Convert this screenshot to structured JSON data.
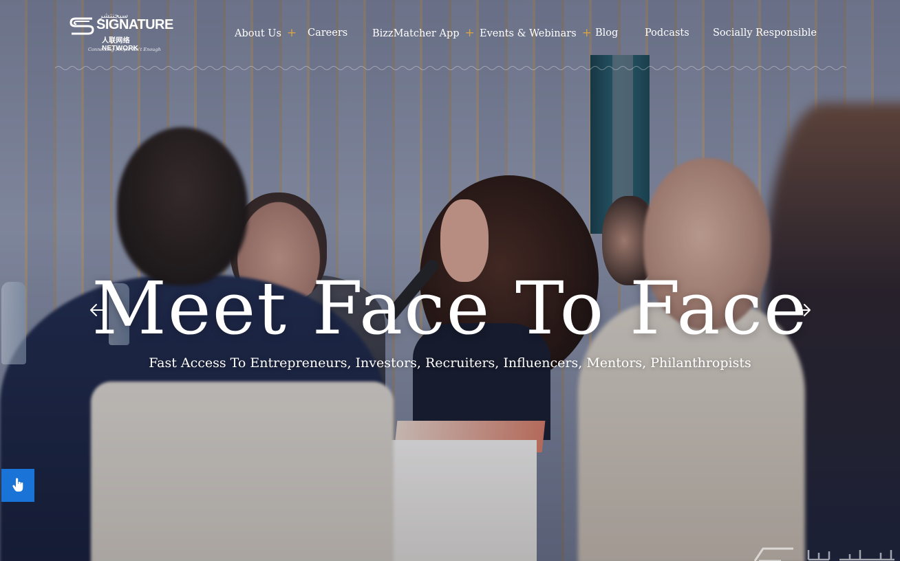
{
  "header": {
    "logo": {
      "brand": "SIGNATURE",
      "arabic": "سيجنتشر",
      "sub": "人联网络 NETWORK",
      "tagline": "Connecting People Isn't Enough"
    },
    "nav": [
      {
        "label": "About Us",
        "has_submenu": true
      },
      {
        "label": "Careers",
        "has_submenu": false
      },
      {
        "label": "BizzMatcher App",
        "has_submenu": true
      },
      {
        "label": "Events & Webinars",
        "has_submenu": true
      },
      {
        "label": "Blog",
        "has_submenu": false
      },
      {
        "label": "Podcasts",
        "has_submenu": false
      },
      {
        "label": "Socially Responsible",
        "has_submenu": false
      }
    ],
    "submenu_glyph": "+"
  },
  "hero": {
    "title": "Meet Face To Face",
    "subtitle": "Fast Access To Entrepreneurs, Investors, Recruiters, Influencers, Mentors, Philanthropists",
    "prev_icon": "arrow-left-icon",
    "next_icon": "arrow-right-icon"
  },
  "accessibility": {
    "icon": "hand-pointer-icon"
  },
  "watermark": {
    "text": "سيجنتشر"
  },
  "colors": {
    "accent_plus": "#d9a441",
    "a11y_button": "#1a73d6",
    "text": "#ffffff"
  }
}
